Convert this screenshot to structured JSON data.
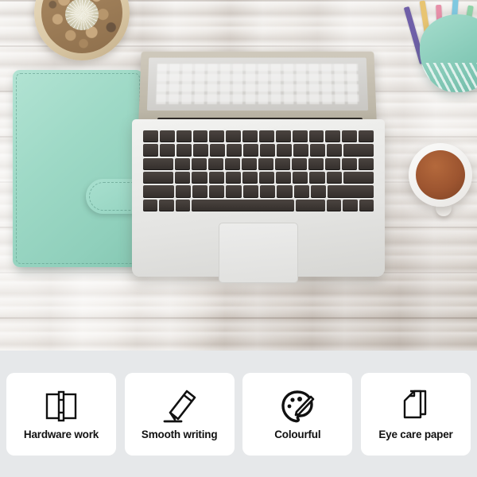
{
  "hero": {
    "alt": "mint green leather notebook, silver laptop, cactus pot, pencil pouch and mug of tea on whitewashed wood desk",
    "objects": [
      {
        "name": "cactus-pot",
        "description": "round wooden pot with pebbles and a white round cactus"
      },
      {
        "name": "mint-notebook",
        "description": "mint green leather ring binder notebook with magnetic flap"
      },
      {
        "name": "laptop",
        "description": "open silver laptop with dark keyboard and trackpad"
      },
      {
        "name": "pencil-pouch",
        "description": "mint green pouch holding coloured pencils"
      },
      {
        "name": "tea-mug",
        "description": "white mug filled with brown tea"
      }
    ],
    "colors": {
      "mint": "#9ed9c6",
      "wood": "#d9d4ce",
      "laptop_silver": "#e4e4e2",
      "tea_brown": "#9d5530"
    }
  },
  "features": {
    "background": "#e6e8ea",
    "card_background": "#ffffff",
    "items": [
      {
        "icon": "notebook-binder-icon",
        "label": "Hardware work"
      },
      {
        "icon": "pencil-writing-icon",
        "label": "Smooth writing"
      },
      {
        "icon": "paint-palette-icon",
        "label": "Colourful"
      },
      {
        "icon": "paper-stack-icon",
        "label": "Eye care paper"
      }
    ]
  }
}
